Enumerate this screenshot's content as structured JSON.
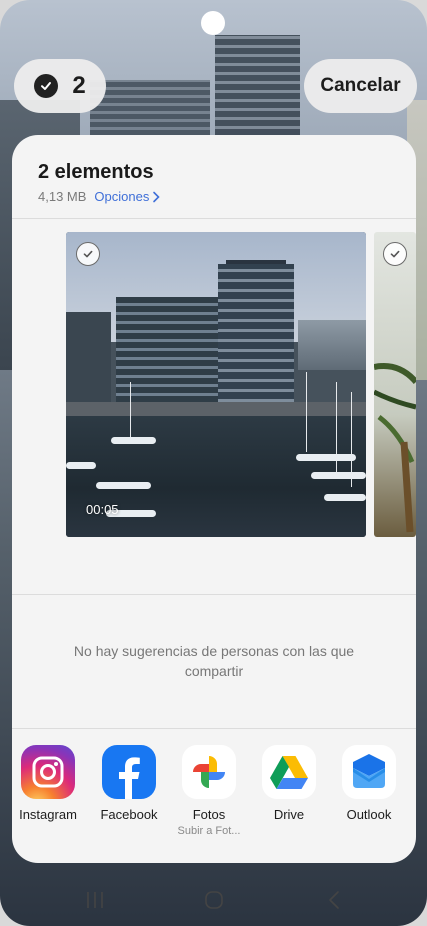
{
  "selection": {
    "count": "2"
  },
  "header": {
    "cancel_label": "Cancelar"
  },
  "sheet": {
    "title": "2 elementos",
    "size": "4,13 MB",
    "options_label": "Opciones"
  },
  "media": [
    {
      "type": "video",
      "duration": "00:05"
    },
    {
      "type": "image"
    }
  ],
  "suggestions_empty": "No hay sugerencias de personas con las que compartir",
  "apps": [
    {
      "label": "Instagram",
      "icon": "instagram-icon"
    },
    {
      "label": "Facebook",
      "icon": "facebook-icon"
    },
    {
      "label": "Fotos",
      "sub": "Subir a Fot...",
      "icon": "google-photos-icon"
    },
    {
      "label": "Drive",
      "icon": "google-drive-icon"
    },
    {
      "label": "Outlook",
      "icon": "outlook-icon"
    }
  ],
  "colors": {
    "link": "#3f6fd8",
    "facebook": "#1877f2",
    "sheet_bg": "#f4f4f4"
  }
}
